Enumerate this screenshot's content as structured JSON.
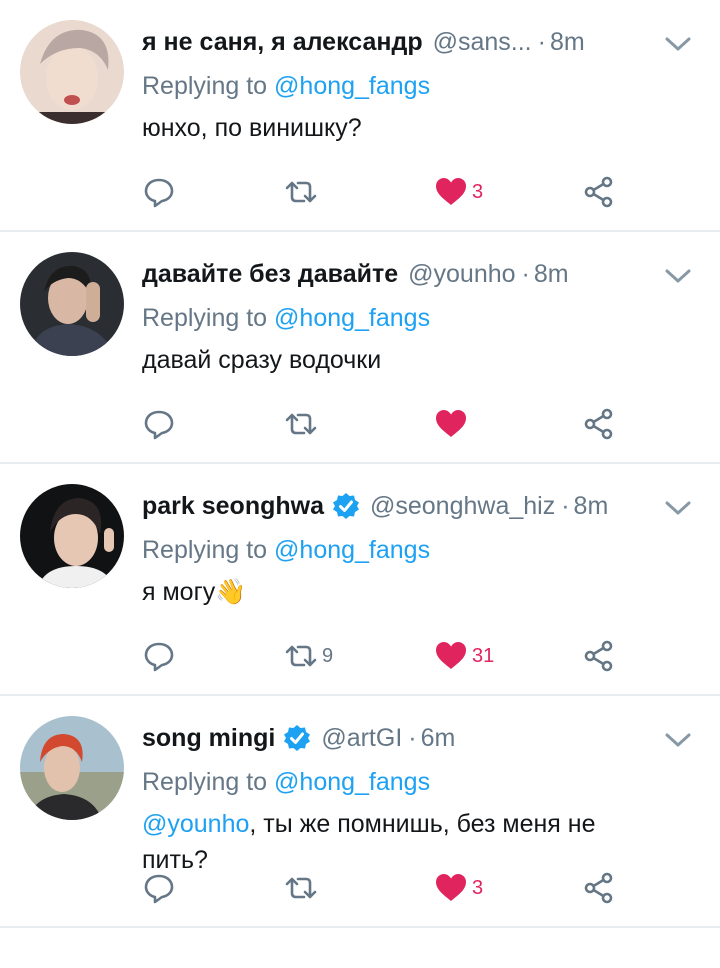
{
  "colors": {
    "link": "#1da1f2",
    "muted": "#657786",
    "like": "#e0245e",
    "divider": "#e6ecf0"
  },
  "replying_label": "Replying to",
  "tweets": [
    {
      "name": "я не саня, я александр",
      "handle": "@sans...",
      "time": "8m",
      "verified": false,
      "replying_to": "@hong_fangs",
      "mention": "",
      "text": "юнхо, по винишку?",
      "retweets": "",
      "likes": "3",
      "liked": true,
      "avatar": "avatar-photo"
    },
    {
      "name": "давайте без давайте",
      "handle": "@younho",
      "time": "8m",
      "verified": false,
      "replying_to": "@hong_fangs",
      "mention": "",
      "text": "давай сразу водочки",
      "retweets": "",
      "likes": "",
      "liked": true,
      "avatar": "avatar-photo"
    },
    {
      "name": "park seonghwa",
      "handle": "@seonghwa_hiz",
      "time": "8m",
      "verified": true,
      "replying_to": "@hong_fangs",
      "mention": "",
      "text": "я могу👋",
      "retweets": "9",
      "likes": "31",
      "liked": true,
      "avatar": "avatar-photo"
    },
    {
      "name": "song mingi",
      "handle": "@artGI",
      "time": "6m",
      "verified": true,
      "replying_to": "@hong_fangs",
      "mention": "@younho",
      "text": ", ты же помнишь, без меня не пить?",
      "retweets": "",
      "likes": "3",
      "liked": true,
      "avatar": "avatar-photo"
    }
  ]
}
